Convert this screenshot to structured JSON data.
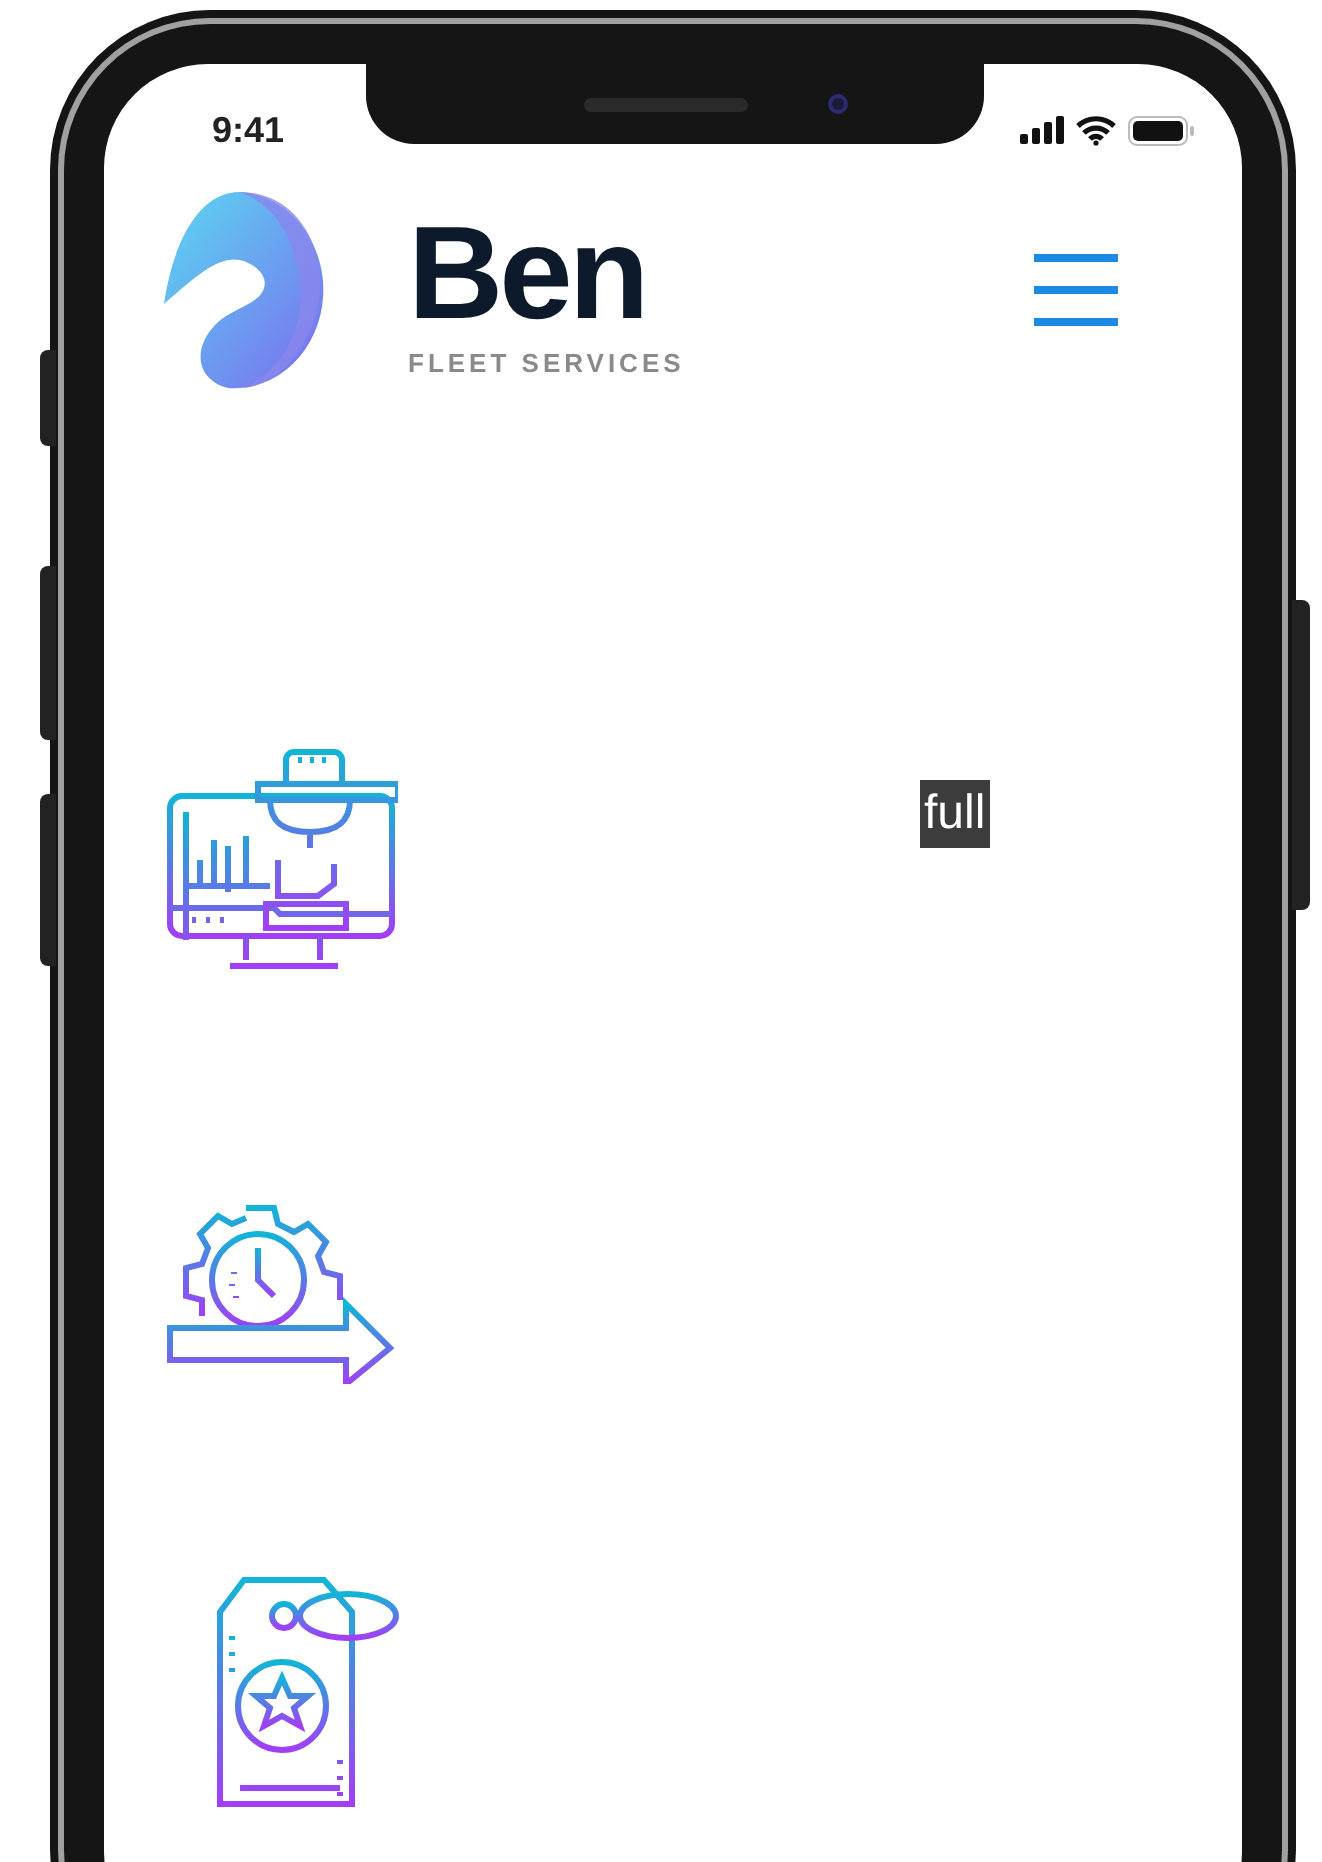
{
  "status_bar": {
    "time": "9:41"
  },
  "header": {
    "brand": "Ben",
    "tagline": "FLEET SERVICES"
  },
  "features": [
    {
      "kind": "monitor",
      "label": "full"
    },
    {
      "kind": "gear-clock"
    },
    {
      "kind": "tag"
    }
  ]
}
